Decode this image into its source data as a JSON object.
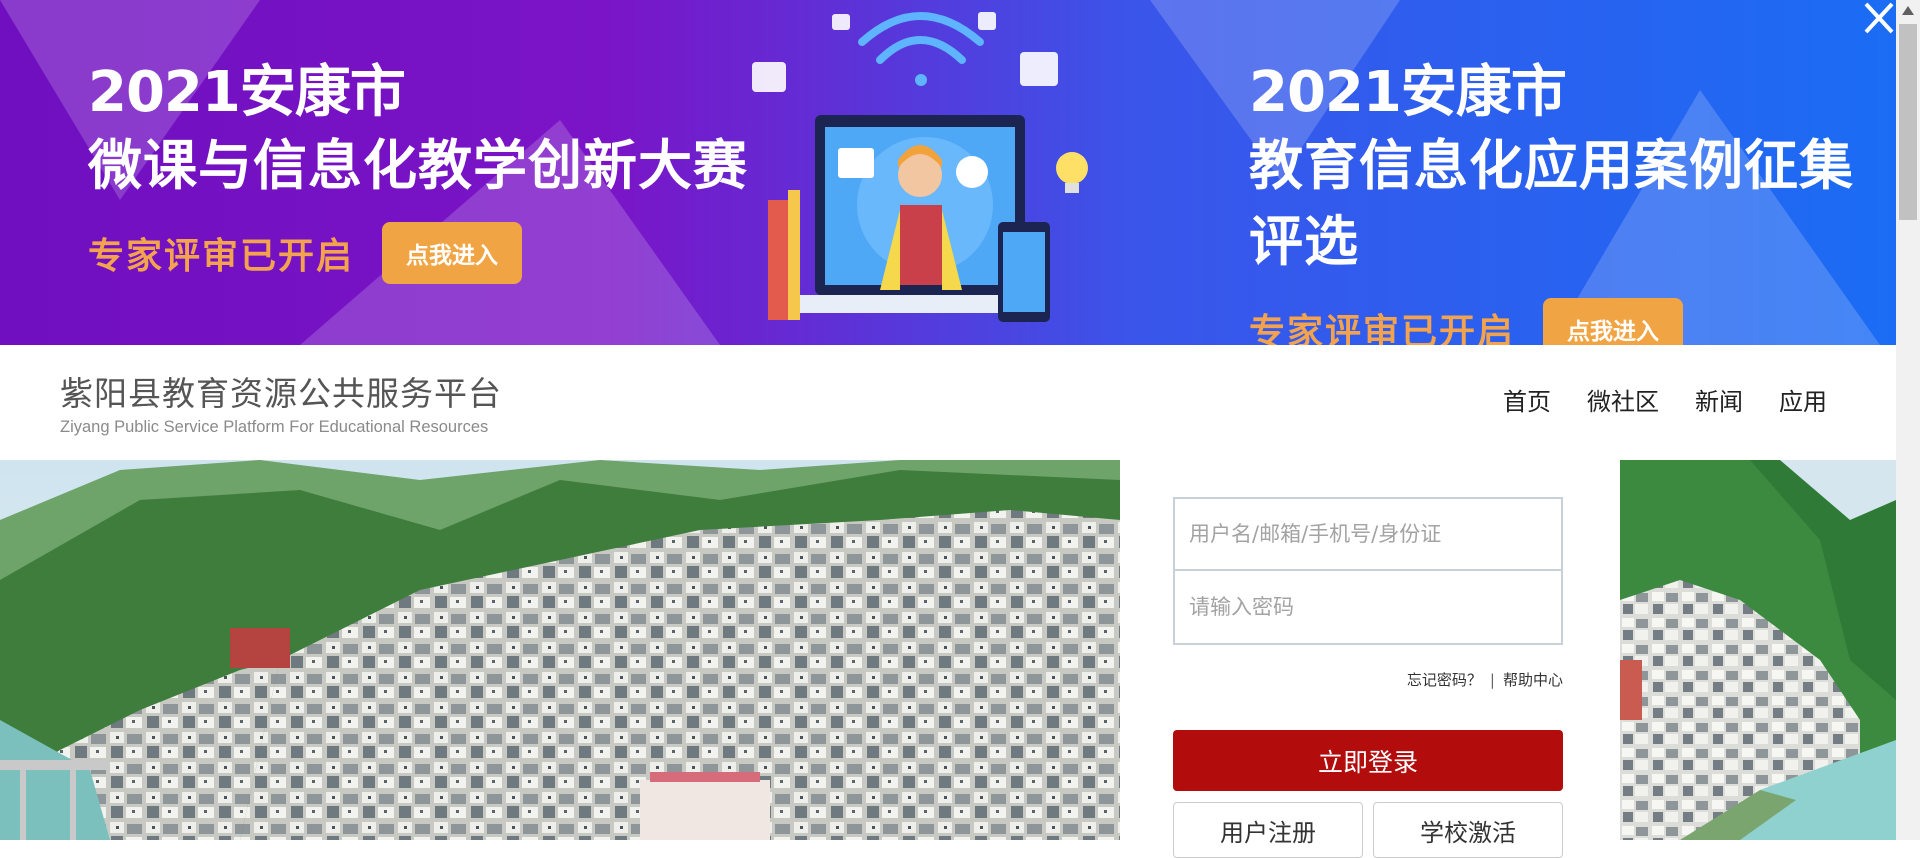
{
  "banner": {
    "left": {
      "year": "2021安康市",
      "title": "微课与信息化教学创新大赛",
      "status": "专家评审已开启",
      "button": "点我进入"
    },
    "right": {
      "year": "2021安康市",
      "title": "教育信息化应用案例征集评选",
      "status": "专家评审已开启",
      "button": "点我进入"
    },
    "colors": {
      "purple": "#7b14c7",
      "blue": "#1b6cf4",
      "accent": "#f0a443",
      "status_text": "#f3a34e"
    }
  },
  "header": {
    "logo_cn": "紫阳县教育资源公共服务平台",
    "logo_en": "Ziyang Public Service Platform For Educational Resources",
    "nav": [
      "首页",
      "微社区",
      "新闻",
      "应用"
    ]
  },
  "login": {
    "username_placeholder": "用户名/邮箱/手机号/身份证",
    "password_placeholder": "请输入密码",
    "forgot_password": "忘记密码？",
    "separator": "|",
    "help_center": "帮助中心",
    "submit": "立即登录",
    "register": "用户注册",
    "school_activate": "学校激活",
    "submit_color": "#b20c0c"
  },
  "icons": [
    "close-icon",
    "scroll-up-arrow-icon",
    "computer-illustration-icon",
    "wifi-icon",
    "gear-icon",
    "chat-bubble-icon",
    "lightbulb-icon"
  ]
}
